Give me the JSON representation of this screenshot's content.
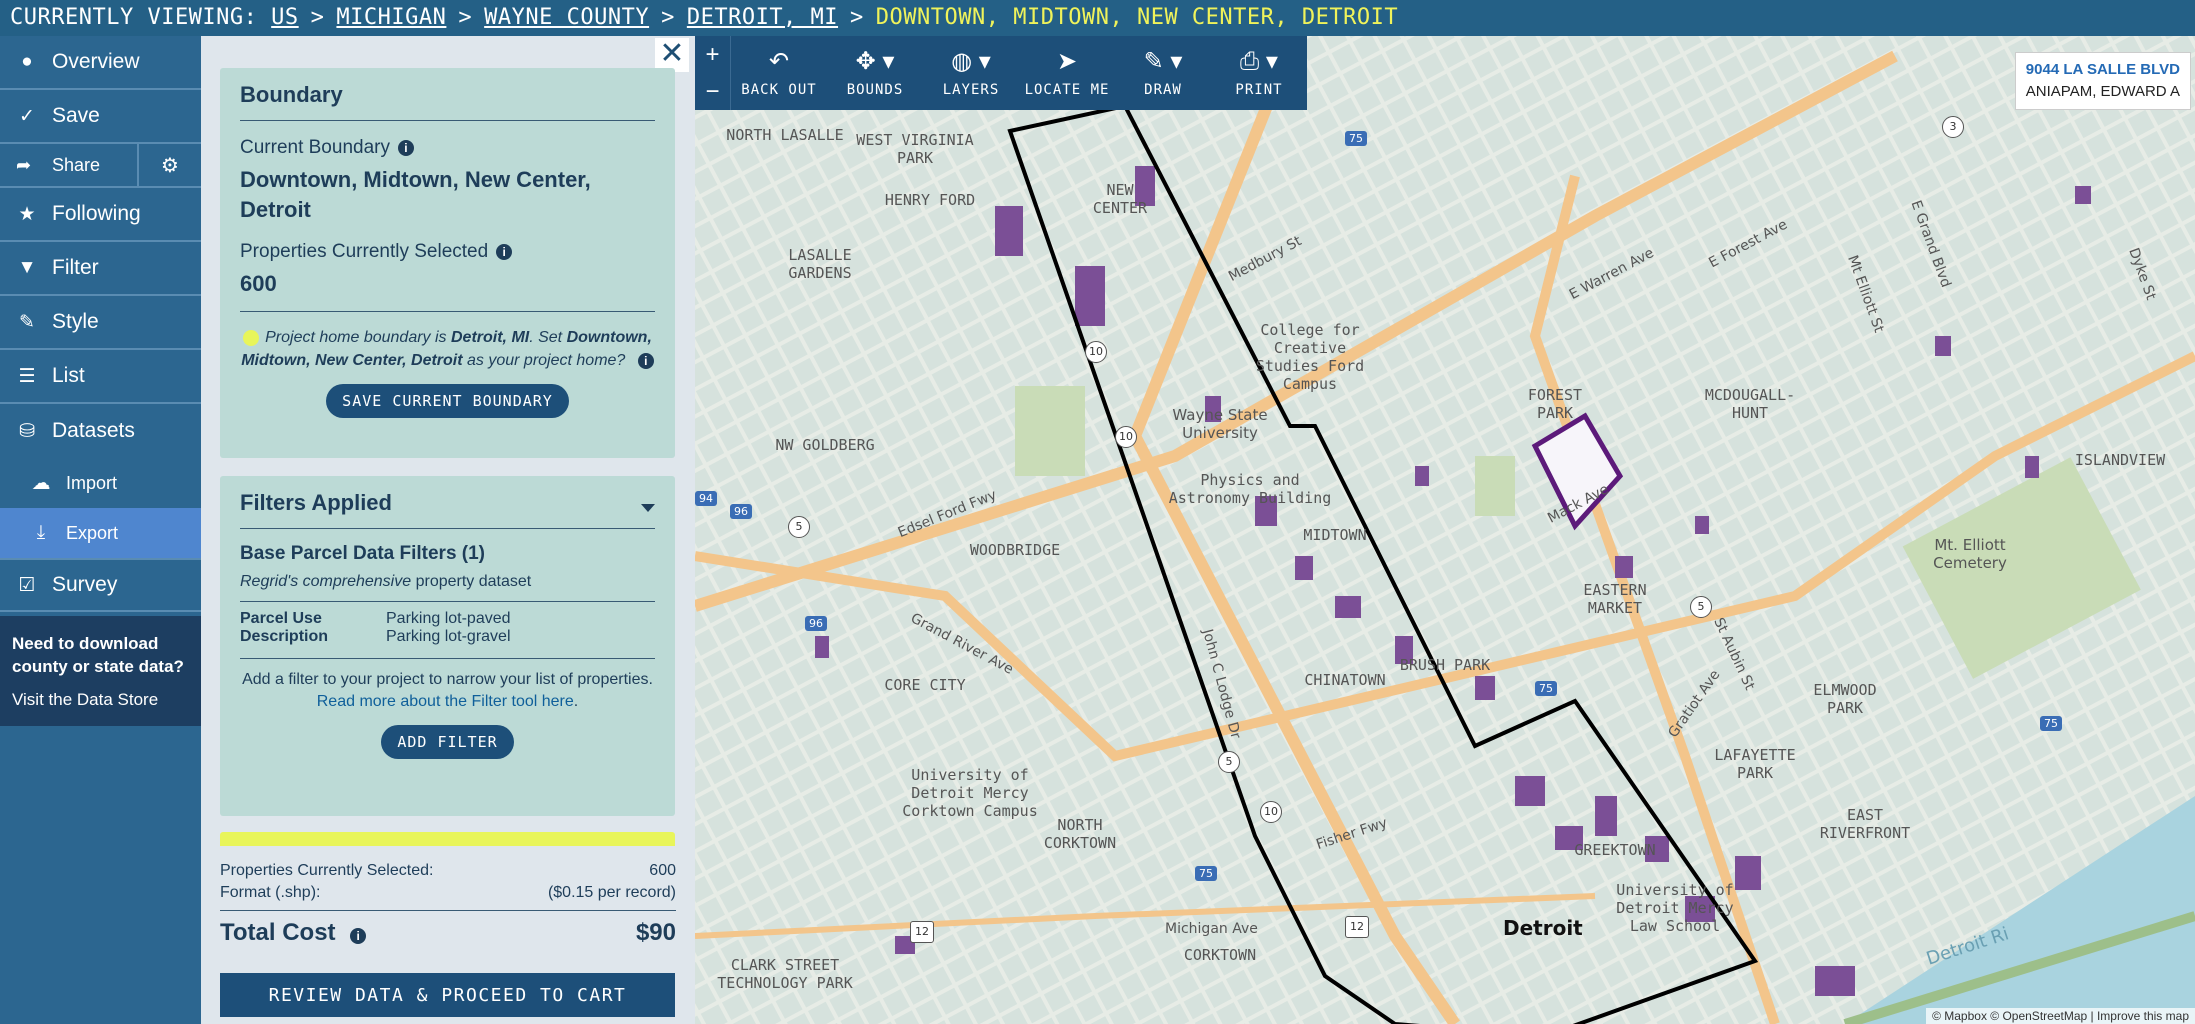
{
  "breadcrumb": {
    "prefix": "CURRENTLY VIEWING:",
    "items": [
      "US",
      "MICHIGAN",
      "WAYNE COUNTY",
      "DETROIT, MI"
    ],
    "separator": ">",
    "current": "DOWNTOWN, MIDTOWN, NEW CENTER, DETROIT"
  },
  "nav": {
    "overview": "Overview",
    "save": "Save",
    "share": "Share",
    "following": "Following",
    "filter": "Filter",
    "style": "Style",
    "list": "List",
    "datasets": "Datasets",
    "import": "Import",
    "export": "Export",
    "survey": "Survey",
    "promo_question": "Need to download county or state data?",
    "promo_link": "Visit the Data Store"
  },
  "boundary": {
    "title": "Boundary",
    "current_label": "Current Boundary",
    "current_value": "Downtown, Midtown, New Center, Detroit",
    "selected_label": "Properties Currently Selected",
    "selected_value": "600",
    "note_a": "Project home boundary is",
    "note_home": "Detroit, MI",
    "note_b": ". Set",
    "note_area": "Downtown, Midtown, New Center, Detroit",
    "note_c": "as your project home?",
    "button": "SAVE CURRENT BOUNDARY"
  },
  "filters": {
    "title": "Filters Applied",
    "group_title": "Base Parcel Data Filters (1)",
    "group_sub_a": "Regrid's comprehensive",
    "group_sub_b": "property dataset",
    "key": "Parcel Use Description",
    "values": [
      "Parking lot-paved",
      "Parking lot-gravel"
    ],
    "help_a": "Add a filter to your project to narrow your list of properties.",
    "help_link": "Read more about the Filter tool here",
    "button": "ADD FILTER"
  },
  "checkout": {
    "selected_label": "Properties Currently Selected:",
    "selected_value": "600",
    "format_label": "Format (.shp):",
    "format_value": "($0.15 per record)",
    "total_label": "Total Cost",
    "total_value": "$90",
    "button": "REVIEW DATA & PROCEED TO CART"
  },
  "toolbar": {
    "back_out": "BACK OUT",
    "bounds": "BOUNDS",
    "layers": "LAYERS",
    "locate_me": "LOCATE ME",
    "draw": "DRAW",
    "print": "PRINT"
  },
  "map": {
    "address_line1": "9044 LA SALLE BLVD",
    "address_line2": "ANIAPAM, EDWARD A",
    "attribution": "© Mapbox © OpenStreetMap | Improve this map",
    "city_label": "Detroit",
    "place_labels": [
      "NORTH LASALLE",
      "WEST VIRGINIA PARK",
      "HENRY FORD",
      "NEW CENTER",
      "LASALLE GARDENS",
      "NW GOLDBERG",
      "WOODBRIDGE",
      "CORE CITY",
      "NORTH CORKTOWN",
      "CORKTOWN",
      "CLARK STREET TECHNOLOGY PARK",
      "FOREST PARK",
      "MCDOUGALL-HUNT",
      "ISLANDVIEW",
      "EASTERN MARKET",
      "ELMWOOD PARK",
      "LAFAYETTE PARK",
      "EAST RIVERFRONT",
      "GREEKTOWN",
      "CHINATOWN",
      "BRUSH PARK",
      "MIDTOWN",
      "Wayne State University",
      "College for Creative Studies Ford Campus",
      "Physics and Astronomy Building",
      "University of Detroit Mercy Corktown Campus",
      "University of Detroit Mercy Law School",
      "Mt. Elliott Cemetery"
    ],
    "road_labels": [
      "Edsel Ford Fwy",
      "Medbury St",
      "E Warren Ave",
      "E Forest Ave",
      "Mack Ave",
      "Grand River Ave",
      "John C Lodge Dr",
      "Fisher Fwy",
      "Michigan Ave",
      "Gratiot Ave",
      "St Aubin St",
      "Mt Elliott St",
      "E Grand Blvd",
      "Dyke St",
      "Detroit Ri"
    ],
    "shields": [
      "75",
      "75",
      "75",
      "75",
      "94",
      "96",
      "96",
      "10",
      "10",
      "10",
      "5",
      "5",
      "5",
      "12",
      "12",
      "3"
    ],
    "colors": {
      "water": "#a9d3df",
      "highway": "#f3c58b",
      "park": "#c9dcb7",
      "parcel": "#7b4f96",
      "boundary": "#000000",
      "home_boundary": "#5c1a7a"
    }
  }
}
